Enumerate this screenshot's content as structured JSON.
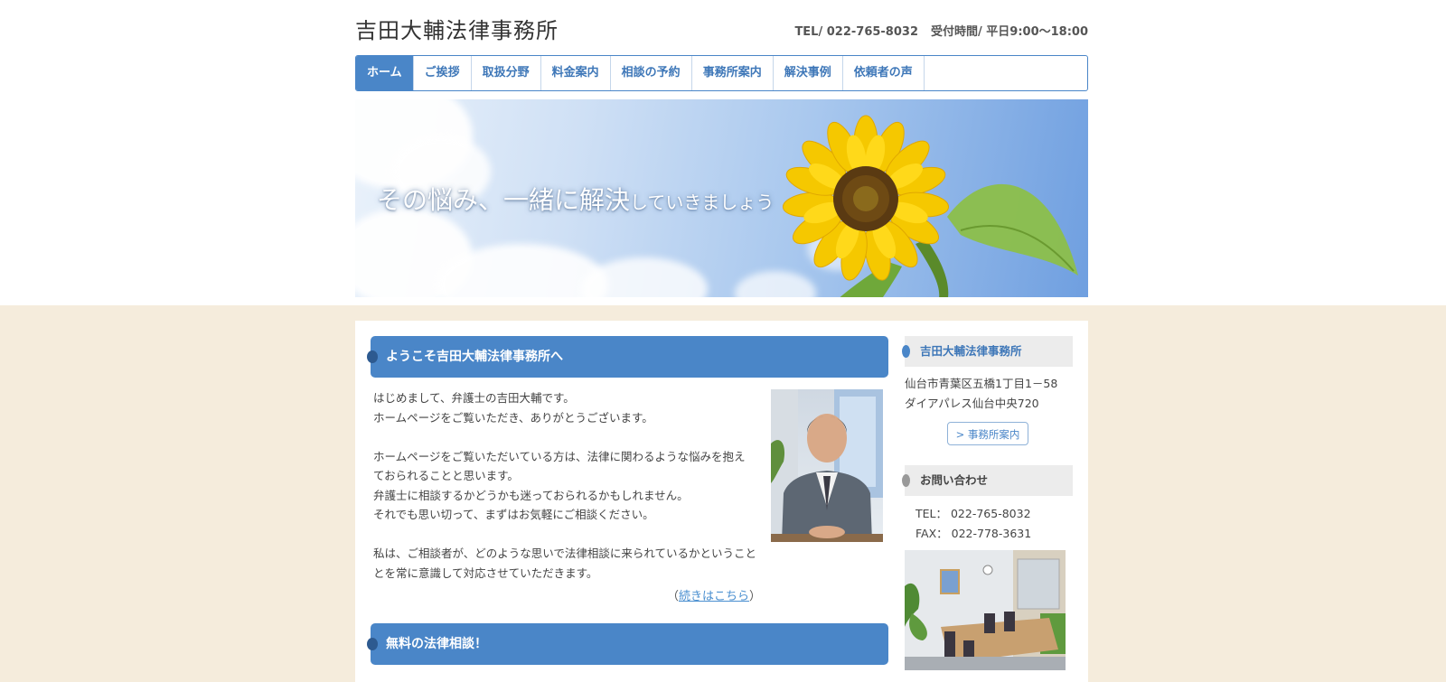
{
  "header": {
    "site_title": "吉田大輔法律事務所",
    "tel": "TEL/ 022-765-8032",
    "hours": "受付時間/ 平日9:00〜18:00"
  },
  "nav": {
    "items": [
      {
        "label": "ホーム",
        "active": true
      },
      {
        "label": "ご挨拶"
      },
      {
        "label": "取扱分野"
      },
      {
        "label": "料金案内"
      },
      {
        "label": "相談の予約"
      },
      {
        "label": "事務所案内"
      },
      {
        "label": "解決事例"
      },
      {
        "label": "依頼者の声"
      }
    ]
  },
  "hero": {
    "tagline_main": "その悩み、一緒に解決",
    "tagline_sub": "していきましょう"
  },
  "main": {
    "welcome_heading": "ようこそ吉田大輔法律事務所へ",
    "paragraphs": [
      "はじめまして、弁護士の吉田大輔です。",
      "ホームページをご覧いただき、ありがとうございます。",
      "",
      "ホームページをご覧いただいている方は、法律に関わるような悩みを抱え",
      "ておられることと思います。",
      "弁護士に相談するかどうかも迷っておられるかもしれません。",
      "それでも思い切って、まずはお気軽にご相談ください。",
      "",
      "私は、ご相談者が、どのような思いで法律相談に来られているかということ",
      "とを常に意識して対応させていただきます。"
    ],
    "more_open": "（",
    "more_link": "続きはこちら",
    "more_close": "）",
    "consult_heading": "無料の法律相談！"
  },
  "sidebar": {
    "office_heading": "吉田大輔法律事務所",
    "address_line1": "仙台市青葉区五橋1丁目1－58",
    "address_line2": "ダイアパレス仙台中央720",
    "office_button": "> 事務所案内",
    "contact_heading": "お問い合わせ",
    "tel_label": "TEL：",
    "tel_value": "022-765-8032",
    "fax_label": "FAX：",
    "fax_value": "022-778-3631"
  },
  "colors": {
    "accent": "#4a86c8",
    "page_bg": "#f5ecdc",
    "link": "#4a8fd0"
  }
}
